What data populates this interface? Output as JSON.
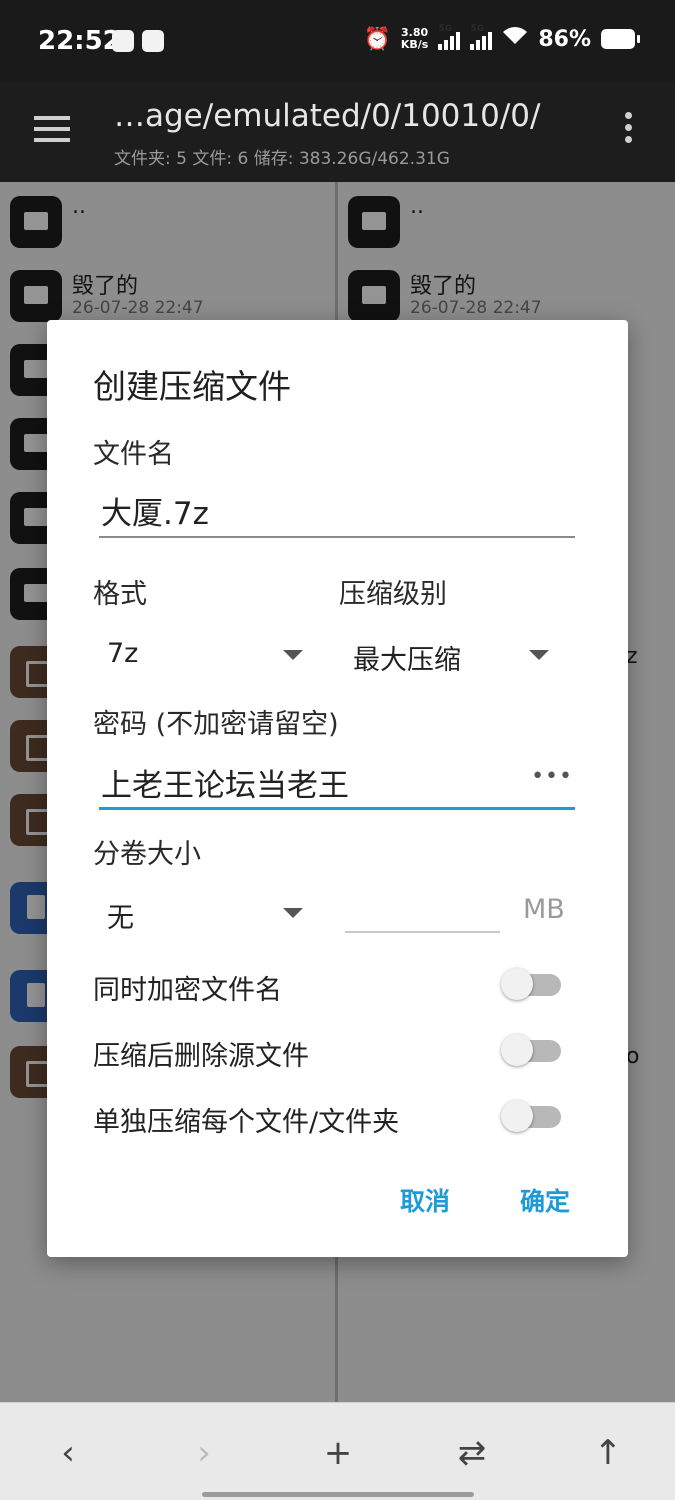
{
  "status_bar": {
    "time": "22:52",
    "net_speed_value": "3.80",
    "net_speed_unit": "KB/s",
    "signal1_label": "5G",
    "signal2_label": "5G",
    "battery": "86%"
  },
  "app_bar": {
    "path": "…age/emulated/0/10010/0/",
    "stats": "文件夹: 5  文件: 6  储存: 383.26G/462.31G"
  },
  "left_pane": {
    "items": [
      {
        "name": "..",
        "date": ""
      },
      {
        "name": "毁了的",
        "date": "26-07-28 22:47"
      }
    ]
  },
  "right_pane": {
    "items": [
      {
        "name": "..",
        "date": ""
      },
      {
        "name": "毁了的",
        "date": "26-07-28 22:47"
      }
    ],
    "partial1": "z",
    "partial2": "o"
  },
  "dialog": {
    "title": "创建压缩文件",
    "filename_label": "文件名",
    "filename_value": "大厦.7z",
    "format_label": "格式",
    "format_value": "7z",
    "level_label": "压缩级别",
    "level_value": "最大压缩",
    "password_label": "密码 (不加密请留空)",
    "password_value": "上老王论坛当老王",
    "password_toggle": "•••",
    "volume_label": "分卷大小",
    "volume_value": "无",
    "volume_unit": "MB",
    "switches": [
      {
        "label": "同时加密文件名",
        "on": false
      },
      {
        "label": "压缩后删除源文件",
        "on": false
      },
      {
        "label": "单独压缩每个文件/文件夹",
        "on": false
      }
    ],
    "cancel_label": "取消",
    "ok_label": "确定"
  },
  "bottom_nav": {
    "back_icon": "‹",
    "forward_icon": "›",
    "add_icon": "+",
    "swap_icon": "⇄",
    "up_icon": "↑"
  },
  "colors": {
    "accent": "#1e9bd7",
    "folder_icon": "#1e1e1e",
    "archive_icon": "#6b4a36",
    "doc_icon": "#2f63b8"
  }
}
